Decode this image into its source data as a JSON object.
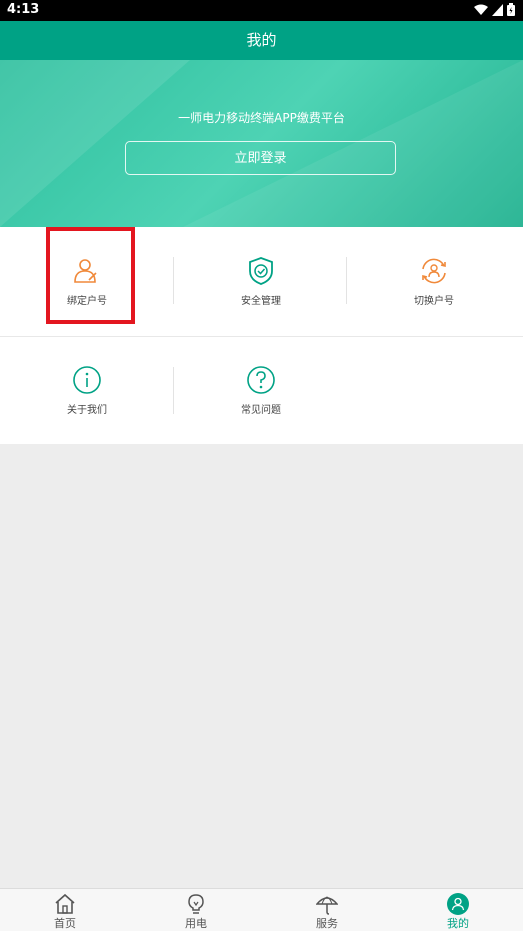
{
  "status_bar": {
    "time": "4:13"
  },
  "header": {
    "title": "我的"
  },
  "banner": {
    "subtitle": "一师电力移动终端APP缴费平台",
    "login_label": "立即登录"
  },
  "menu": {
    "bind_account": "绑定户号",
    "security": "安全管理",
    "switch_account": "切换户号",
    "about_us": "关于我们",
    "faq": "常见问题"
  },
  "tabs": {
    "home": "首页",
    "electricity": "用电",
    "service": "服务",
    "mine": "我的"
  },
  "colors": {
    "primary": "#00a285",
    "orange": "#f0893a",
    "highlight": "#e3161f"
  }
}
